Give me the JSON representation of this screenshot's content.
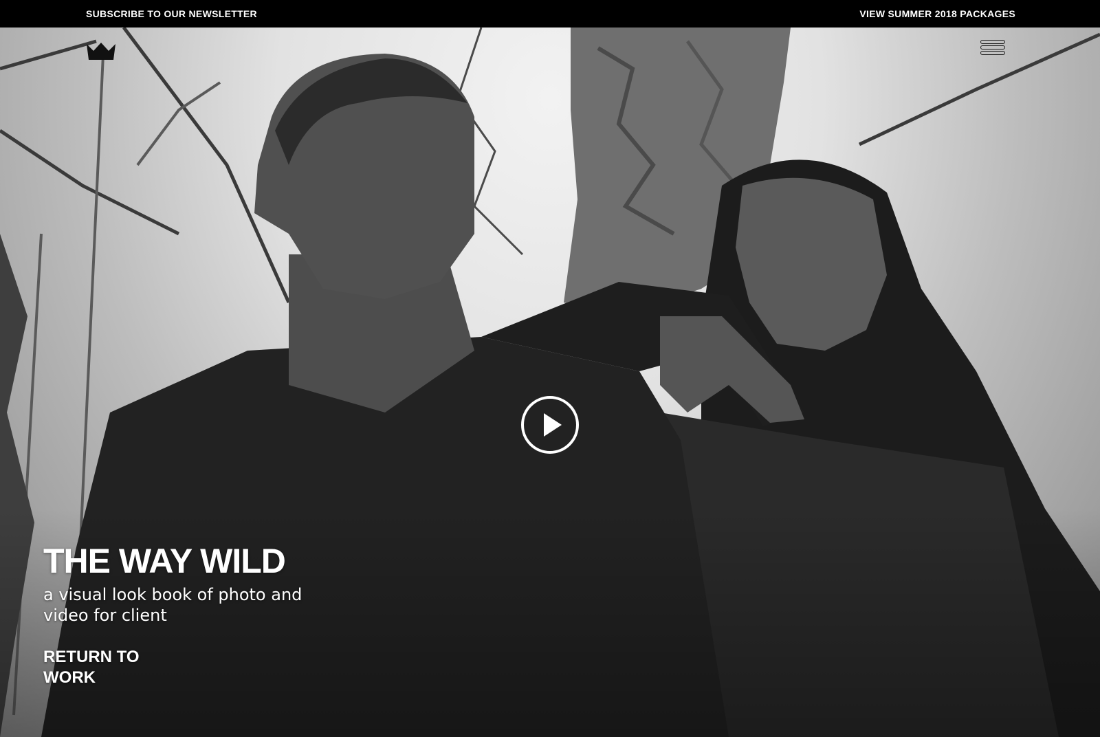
{
  "topbar": {
    "newsletter_label": "SUBSCRIBE TO OUR NEWSLETTER",
    "packages_label": "VIEW SUMMER 2018 PACKAGES"
  },
  "header": {
    "logo_icon": "crown-icon",
    "menu_icon": "hamburger-menu-icon"
  },
  "hero": {
    "title": "THE WAY WILD",
    "subtitle": "a visual look book of photo and video for client",
    "return_label": "RETURN TO WORK",
    "play_icon": "play-icon"
  },
  "colors": {
    "bar": "#000000",
    "text_light": "#ffffff",
    "icon_dark": "#1a1a1a"
  }
}
